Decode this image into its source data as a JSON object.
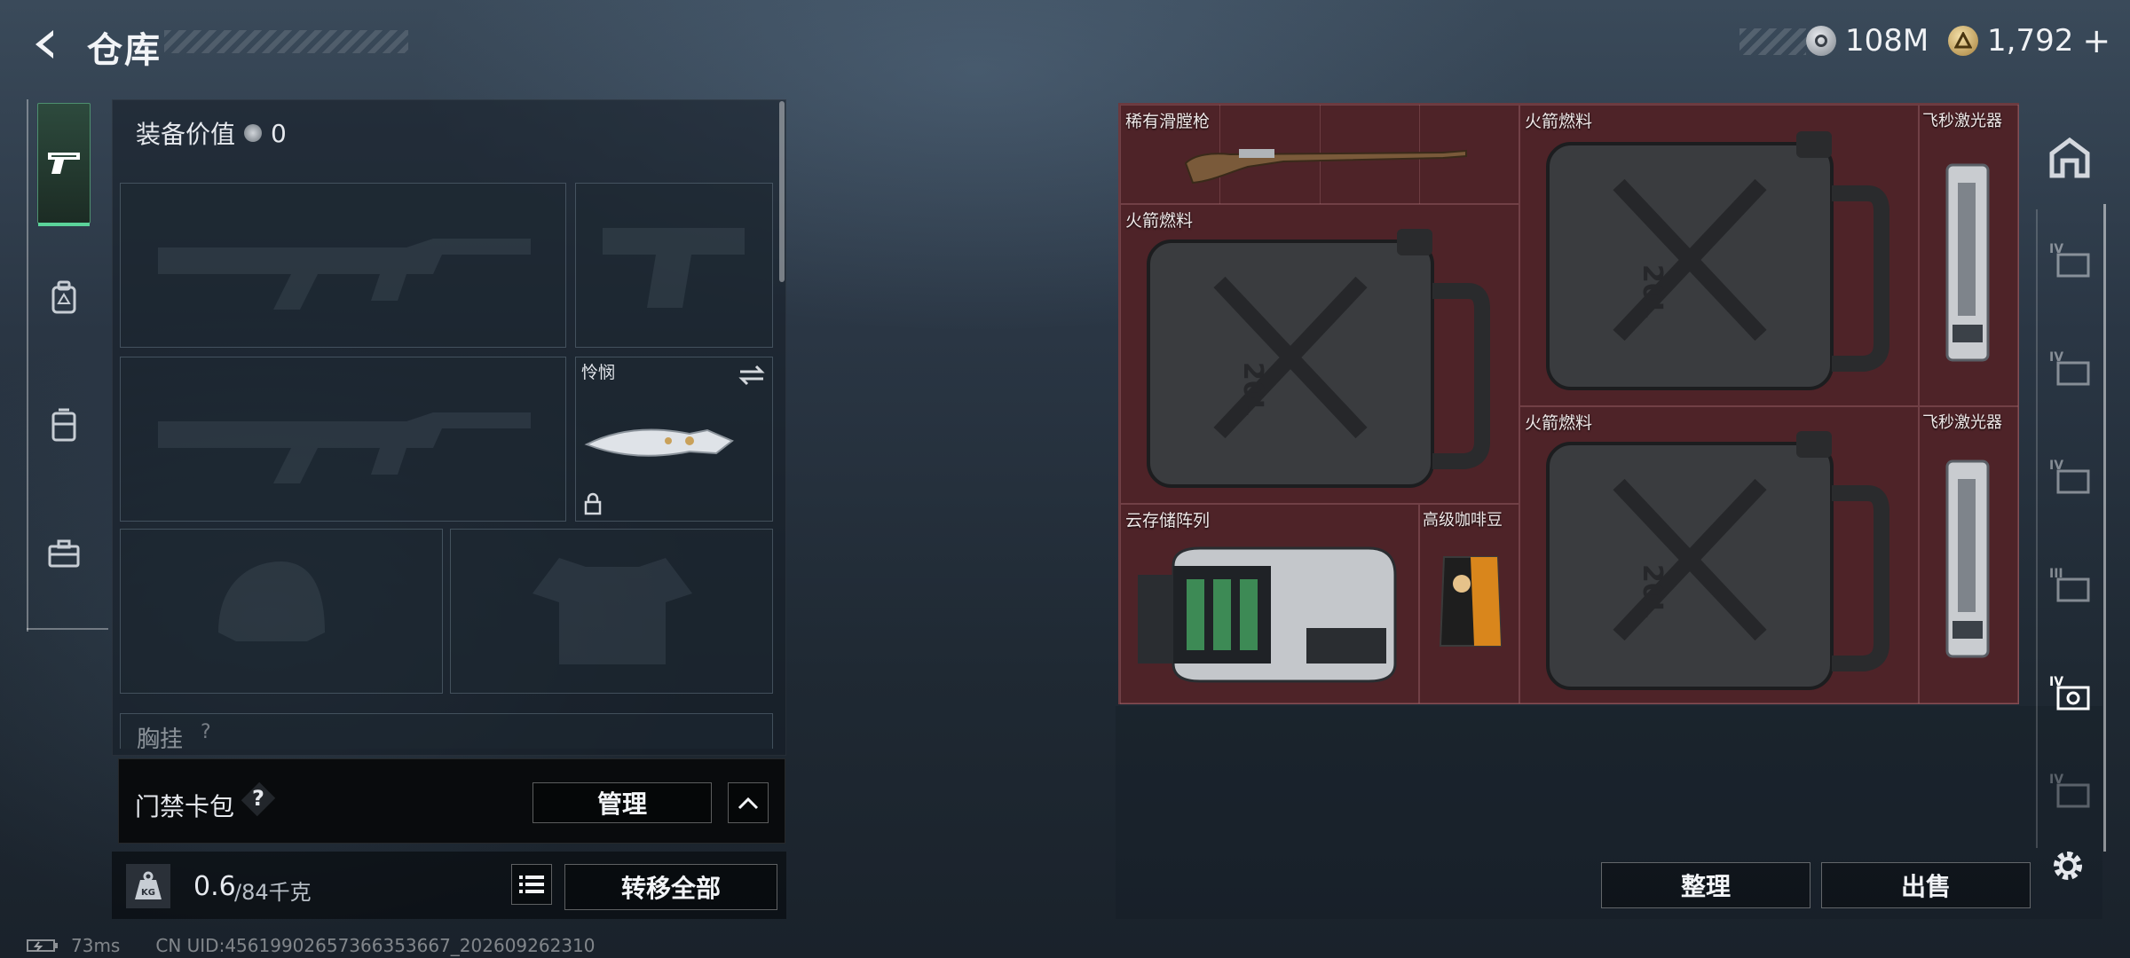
{
  "header": {
    "title": "仓库",
    "currency": [
      {
        "icon": "silver-coin-icon",
        "value": "108M"
      },
      {
        "icon": "gold-coin-icon",
        "value": "1,792"
      }
    ],
    "add_symbol": "+"
  },
  "left_nav": {
    "items": [
      {
        "name": "pistol-icon",
        "active": true
      },
      {
        "name": "backpack-icon",
        "active": false
      },
      {
        "name": "chest-rig-icon",
        "active": false
      },
      {
        "name": "toolbox-icon",
        "active": false
      }
    ]
  },
  "equipment": {
    "value_label": "装备价值",
    "value": "0",
    "melee_slot_label": "怜悯",
    "chest_rig_label": "胸挂",
    "help_symbol": "?"
  },
  "keycard": {
    "label": "门禁卡包",
    "help_symbol": "?",
    "manage_button": "管理"
  },
  "weight": {
    "kg_icon_text": "KG",
    "current": "0.6",
    "capacity": "/84千克",
    "transfer_all_button": "转移全部"
  },
  "status": {
    "ping": "73ms",
    "uid": "CN UID:4561990265736635366​7_202609262310"
  },
  "storage": {
    "items": [
      {
        "label": "稀有滑膛枪",
        "icon": "musket-icon"
      },
      {
        "label": "火箭燃料",
        "icon": "fuel-jerrycan-icon"
      },
      {
        "label": "飞秒激光器",
        "icon": "laser-device-icon"
      },
      {
        "label": "火箭燃料",
        "icon": "fuel-jerrycan-icon"
      },
      {
        "label": "火箭燃料",
        "icon": "fuel-jerrycan-icon"
      },
      {
        "label": "飞秒激光器",
        "icon": "laser-device-icon"
      },
      {
        "label": "云存储阵列",
        "icon": "server-array-icon"
      },
      {
        "label": "高级咖啡豆",
        "icon": "coffee-bag-icon"
      }
    ],
    "can_text": "20L",
    "sort_button": "整理",
    "sell_button": "出售"
  },
  "right_nav": {
    "tabs": [
      "IV",
      "IV",
      "IV",
      "III",
      "IV",
      "IV"
    ]
  },
  "colors": {
    "accent_green": "#5bd39a",
    "storage_bg": "#4e2328"
  }
}
